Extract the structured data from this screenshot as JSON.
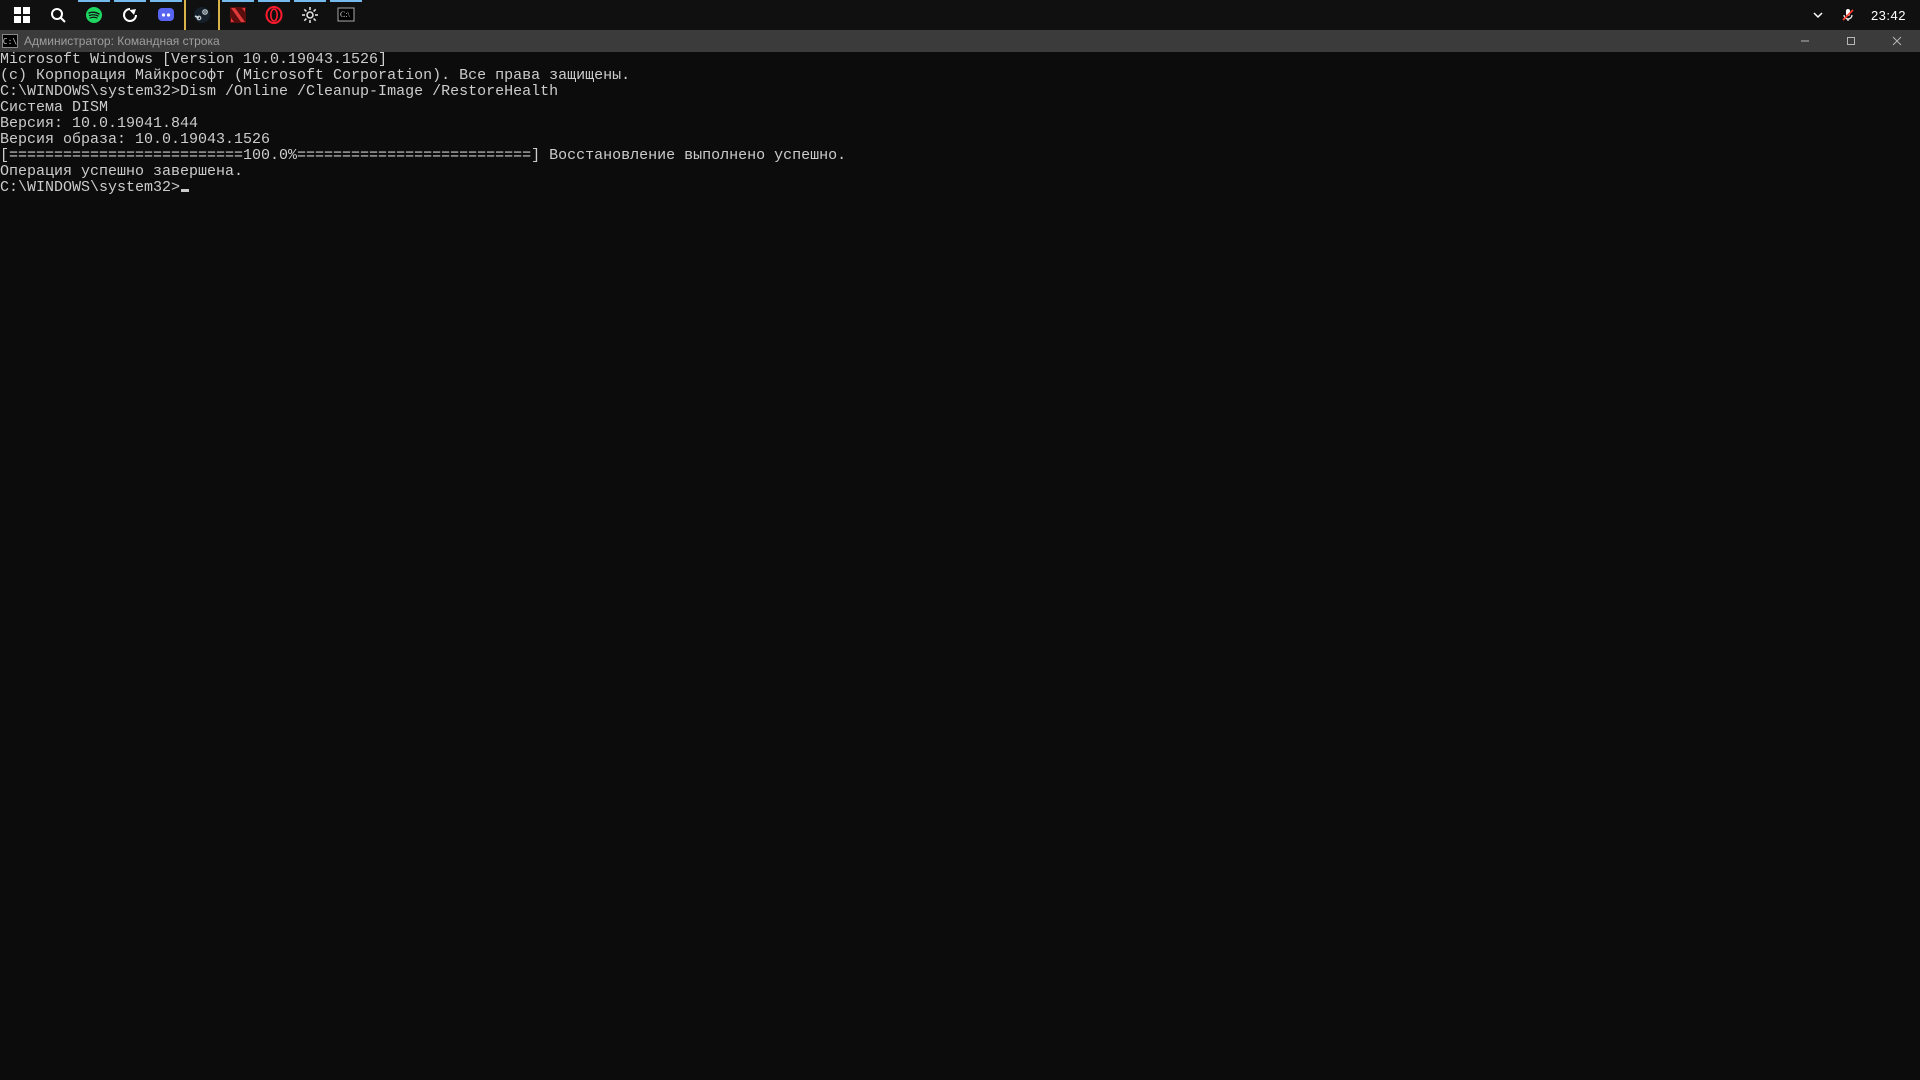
{
  "taskbar": {
    "items": [
      {
        "name": "start",
        "icon": "windows"
      },
      {
        "name": "search",
        "icon": "search"
      },
      {
        "name": "spotify",
        "icon": "spotify"
      },
      {
        "name": "sync",
        "icon": "sync"
      },
      {
        "name": "discord",
        "icon": "discord"
      },
      {
        "name": "steam",
        "icon": "steam"
      },
      {
        "name": "dota",
        "icon": "dota"
      },
      {
        "name": "opera",
        "icon": "opera"
      },
      {
        "name": "settings",
        "icon": "gear"
      },
      {
        "name": "cmd",
        "icon": "cmd"
      }
    ],
    "tray": {
      "chevron": "chevron-down",
      "mic": "mic-muted",
      "clock": "23:42"
    }
  },
  "window": {
    "title": "Администратор: Командная строка"
  },
  "console": {
    "lines": [
      "Microsoft Windows [Version 10.0.19043.1526]",
      "(c) Корпорация Майкрософт (Microsoft Corporation). Все права защищены.",
      "",
      "C:\\WINDOWS\\system32>Dism /Online /Cleanup-Image /RestoreHealth",
      "",
      "Cистема DISM",
      "Версия: 10.0.19041.844",
      "",
      "Версия образа: 10.0.19043.1526",
      "",
      "[==========================100.0%==========================] Восстановление выполнено успешно.",
      "Операция успешно завершена.",
      ""
    ],
    "prompt": "C:\\WINDOWS\\system32>"
  }
}
